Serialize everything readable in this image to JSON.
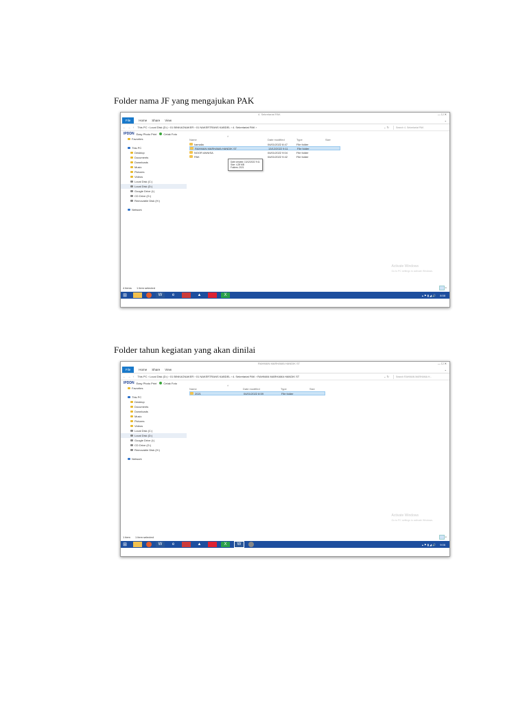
{
  "captions": [
    "Folder nama JF yang mengajukan PAK",
    "Folder tahun kegiatan yang akan dinilai"
  ],
  "ribbon": {
    "file": "File",
    "tabs": [
      "Home",
      "Share",
      "View"
    ]
  },
  "nav_pane": {
    "favorites": "Favorites",
    "this_pc": "This PC",
    "items": [
      "Desktop",
      "Documents",
      "Downloads",
      "Music",
      "Pictures",
      "Videos",
      "Local Disk (C:)",
      "Local Disk (D:)",
      "Google Drive (I:)",
      "CD Drive (G:)",
      "Removable Disk (H:)"
    ],
    "network": "Network"
  },
  "bookmarks": {
    "logo": "IPDDN",
    "items": [
      "Easy Photo Print",
      "Cetak Foto"
    ]
  },
  "columns": [
    "Name",
    "Date modified",
    "Type",
    "Size"
  ],
  "activate": {
    "title": "Activate Windows",
    "sub": "Go to PC settings to activate Windows."
  },
  "screens": [
    {
      "window_title": "4. Sekretariat PAK",
      "path": "This PC  ›  Local Disk (D:)  ›  01 BINKAGNAKER  ›  01 NAKERTRANS KABDEL  ›  4. Sekretariat PAK  ›",
      "search": "Search 4. Sekretariat PAK",
      "files": [
        {
          "name": "kamalia",
          "date": "04/01/2022 8:47",
          "type": "File folder",
          "size": ""
        },
        {
          "name": "RAHMAN MARHAMA HANDIK ST",
          "date": "13/12/2022 9:11",
          "type": "File folder",
          "size": ""
        },
        {
          "name": "NOOR ANNISA",
          "date": "04/01/2022 9:04",
          "type": "File folder",
          "size": ""
        },
        {
          "name": "PAK",
          "date": "04/01/2022 9:42",
          "type": "File folder",
          "size": ""
        }
      ],
      "selected_row": 1,
      "tooltip": [
        "Date created: 13/12/2022 9:11",
        "Size: 4,39 MB",
        "Folders: 2021"
      ],
      "status_count": "4 items",
      "status_sel": "1 item selected",
      "taskbar_clock": "8:58"
    },
    {
      "window_title": "RAHMAN MARHAMA HANDIK ST",
      "path": "This PC  ›  Local Disk (D:)  ›  01 BINKAGNAKER  ›  01 NAKERTRANS KABDEL  ›  4. Sekretariat PAK  ›  RAHMAN MARHAMA HANDIK ST",
      "search": "Search RAHMAN MARHAMA H...",
      "files": [
        {
          "name": "2021",
          "date": "04/01/2022 8:59",
          "type": "File folder",
          "size": ""
        }
      ],
      "selected_row": 0,
      "status_count": "1 item",
      "status_sel": "1 item selected",
      "taskbar_clock": "9:06"
    }
  ]
}
